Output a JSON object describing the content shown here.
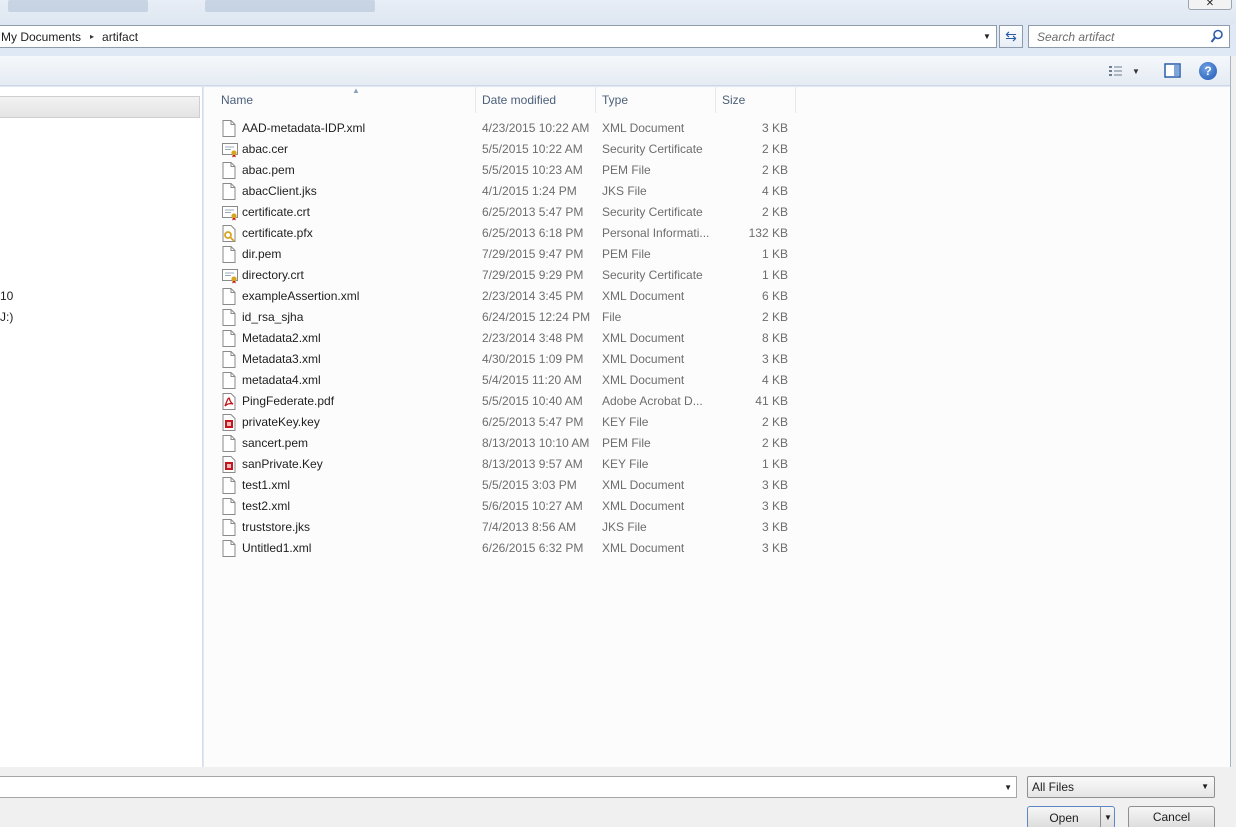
{
  "window": {
    "close_glyph": "✕"
  },
  "address_bar": {
    "crumbs": [
      "My Documents",
      "artifact"
    ],
    "separator": "▸",
    "dropdown_glyph": "▼",
    "refresh_glyph": "⇆"
  },
  "search": {
    "placeholder": "Search artifact"
  },
  "toolbar": {
    "view_dropdown_glyph": "▼",
    "help_label": "?"
  },
  "nav_pane": {
    "partial_items": [
      "10",
      "J:)"
    ]
  },
  "columns": {
    "name": "Name",
    "date_modified": "Date modified",
    "type": "Type",
    "size": "Size",
    "sort_glyph": "▲"
  },
  "files": [
    {
      "name": "AAD-metadata-IDP.xml",
      "date": "4/23/2015 10:22 AM",
      "type": "XML Document",
      "size": "3 KB",
      "icon": "document-icon"
    },
    {
      "name": "abac.cer",
      "date": "5/5/2015 10:22 AM",
      "type": "Security Certificate",
      "size": "2 KB",
      "icon": "certificate-icon"
    },
    {
      "name": "abac.pem",
      "date": "5/5/2015 10:23 AM",
      "type": "PEM File",
      "size": "2 KB",
      "icon": "document-icon"
    },
    {
      "name": "abacClient.jks",
      "date": "4/1/2015 1:24 PM",
      "type": "JKS File",
      "size": "4 KB",
      "icon": "document-icon"
    },
    {
      "name": "certificate.crt",
      "date": "6/25/2013 5:47 PM",
      "type": "Security Certificate",
      "size": "2 KB",
      "icon": "certificate-icon"
    },
    {
      "name": "certificate.pfx",
      "date": "6/25/2013 6:18 PM",
      "type": "Personal Informati...",
      "size": "132 KB",
      "icon": "pfx-icon"
    },
    {
      "name": "dir.pem",
      "date": "7/29/2015 9:47 PM",
      "type": "PEM File",
      "size": "1 KB",
      "icon": "document-icon"
    },
    {
      "name": "directory.crt",
      "date": "7/29/2015 9:29 PM",
      "type": "Security Certificate",
      "size": "1 KB",
      "icon": "certificate-icon"
    },
    {
      "name": "exampleAssertion.xml",
      "date": "2/23/2014 3:45 PM",
      "type": "XML Document",
      "size": "6 KB",
      "icon": "document-icon"
    },
    {
      "name": "id_rsa_sjha",
      "date": "6/24/2015 12:24 PM",
      "type": "File",
      "size": "2 KB",
      "icon": "document-icon"
    },
    {
      "name": "Metadata2.xml",
      "date": "2/23/2014 3:48 PM",
      "type": "XML Document",
      "size": "8 KB",
      "icon": "document-icon"
    },
    {
      "name": "Metadata3.xml",
      "date": "4/30/2015 1:09 PM",
      "type": "XML Document",
      "size": "3 KB",
      "icon": "document-icon"
    },
    {
      "name": "metadata4.xml",
      "date": "5/4/2015 11:20 AM",
      "type": "XML Document",
      "size": "4 KB",
      "icon": "document-icon"
    },
    {
      "name": "PingFederate.pdf",
      "date": "5/5/2015 10:40 AM",
      "type": "Adobe Acrobat D...",
      "size": "41 KB",
      "icon": "pdf-icon"
    },
    {
      "name": "privateKey.key",
      "date": "6/25/2013 5:47 PM",
      "type": "KEY File",
      "size": "2 KB",
      "icon": "key-file-icon"
    },
    {
      "name": "sancert.pem",
      "date": "8/13/2013 10:10 AM",
      "type": "PEM File",
      "size": "2 KB",
      "icon": "document-icon"
    },
    {
      "name": "sanPrivate.Key",
      "date": "8/13/2013 9:57 AM",
      "type": "KEY File",
      "size": "1 KB",
      "icon": "key-file-icon"
    },
    {
      "name": "test1.xml",
      "date": "5/5/2015 3:03 PM",
      "type": "XML Document",
      "size": "3 KB",
      "icon": "document-icon"
    },
    {
      "name": "test2.xml",
      "date": "5/6/2015 10:27 AM",
      "type": "XML Document",
      "size": "3 KB",
      "icon": "document-icon"
    },
    {
      "name": "truststore.jks",
      "date": "7/4/2013 8:56 AM",
      "type": "JKS File",
      "size": "3 KB",
      "icon": "document-icon"
    },
    {
      "name": "Untitled1.xml",
      "date": "6/26/2015 6:32 PM",
      "type": "XML Document",
      "size": "3 KB",
      "icon": "document-icon"
    }
  ],
  "bottom": {
    "filename_value": "",
    "filetype_selected": "All Files",
    "open_label": "Open",
    "cancel_label": "Cancel",
    "dropdown_glyph": "▼"
  },
  "colors": {
    "accent": "#2a5da8",
    "pdf_red": "#c4161c",
    "cert_gold": "#d9a520"
  }
}
